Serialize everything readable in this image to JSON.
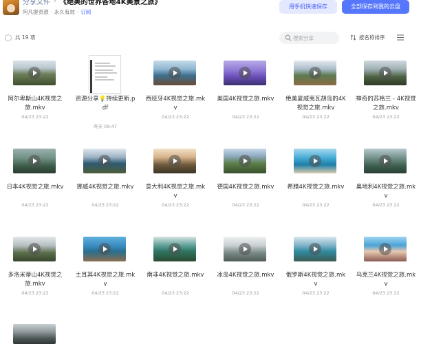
{
  "header": {
    "breadcrumb_root": "分享文件",
    "breadcrumb_separator": "›",
    "share_title": "《绝美的世界各地4K美景之旅》",
    "owner": "阿凡提资源",
    "sub_separator": "·",
    "validity": "永久有效",
    "subscribe_label": "订阅",
    "phone_save_label": "用手机快速保存",
    "save_all_label": "全部保存到我的云盘"
  },
  "toolbar": {
    "count_label": "共 19 项",
    "search_placeholder": "搜索分享",
    "sort_label": "按名称排序"
  },
  "colors": {
    "accent": "#5677fc",
    "accent_light": "#e4e9ff",
    "link": "#4c6fff"
  },
  "files": [
    {
      "name": "阿尔卑斯山4K视觉之旅.mkv",
      "date": "04/23 23:22",
      "type": "video",
      "icon": "video-thumbnail"
    },
    {
      "name": "资源分享💡持续更新.pdf",
      "date": "昨天 09:47",
      "type": "pdf",
      "icon": "pdf-thumbnail"
    },
    {
      "name": "西班牙4K视觉之旅.mkv",
      "date": "04/23 23:22",
      "type": "video",
      "icon": "video-thumbnail"
    },
    {
      "name": "美国4K视觉之旅.mkv",
      "date": "04/23 23:22",
      "type": "video",
      "icon": "video-thumbnail"
    },
    {
      "name": "绝美夏威夷瓦胡岛的4K视觉之旅.mkv",
      "date": "04/23 23:22",
      "type": "video",
      "icon": "video-thumbnail"
    },
    {
      "name": "神奇的苏格兰 - 4K视觉之旅.mkv",
      "date": "04/23 23:22",
      "type": "video",
      "icon": "video-thumbnail"
    },
    {
      "name": "日本4K视觉之旅.mkv",
      "date": "04/23 23:22",
      "type": "video",
      "icon": "video-thumbnail"
    },
    {
      "name": "挪威4K视觉之旅.mkv",
      "date": "04/23 23:22",
      "type": "video",
      "icon": "video-thumbnail"
    },
    {
      "name": "意大利4K视觉之旅.mkv",
      "date": "04/23 23:22",
      "type": "video",
      "icon": "video-thumbnail"
    },
    {
      "name": "德国4K视觉之旅.mkv",
      "date": "04/23 23:22",
      "type": "video",
      "icon": "video-thumbnail"
    },
    {
      "name": "希腊4K视觉之旅.mkv",
      "date": "04/23 23:22",
      "type": "video",
      "icon": "video-thumbnail"
    },
    {
      "name": "奥地利4K视觉之旅.mkv",
      "date": "04/23 23:22",
      "type": "video",
      "icon": "video-thumbnail"
    },
    {
      "name": "多洛米蒂山4K视觉之旅.mkv",
      "date": "04/23 23:22",
      "type": "video",
      "icon": "video-thumbnail"
    },
    {
      "name": "土耳其4K视觉之旅.mkv",
      "date": "04/23 23:22",
      "type": "video",
      "icon": "video-thumbnail"
    },
    {
      "name": "南非4K视觉之旅.mkv",
      "date": "04/23 23:22",
      "type": "video",
      "icon": "video-thumbnail"
    },
    {
      "name": "冰岛4K视觉之旅.mkv",
      "date": "04/23 23:22",
      "type": "video",
      "icon": "video-thumbnail"
    },
    {
      "name": "俄罗斯4K视觉之旅.mkv",
      "date": "04/23 23:22",
      "type": "video",
      "icon": "video-thumbnail"
    },
    {
      "name": "乌克兰4K视觉之旅.mkv",
      "date": "04/23 23:22",
      "type": "video",
      "icon": "video-thumbnail"
    },
    {
      "name": "",
      "date": "",
      "type": "video",
      "icon": "video-thumbnail"
    }
  ]
}
